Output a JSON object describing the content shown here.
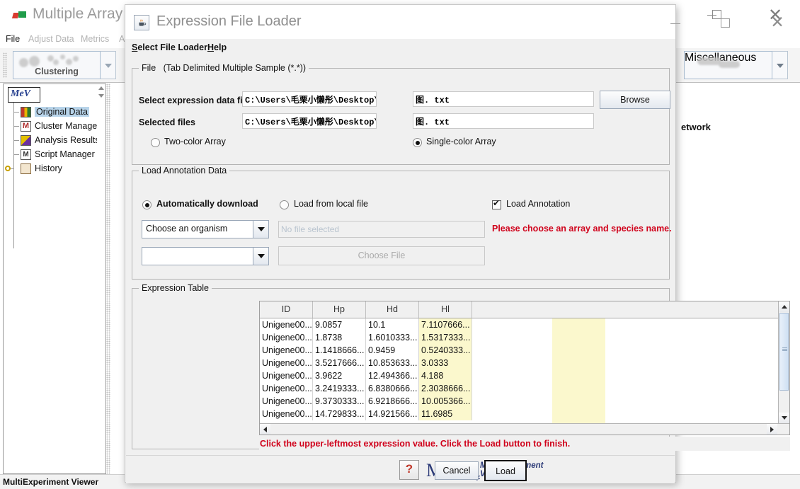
{
  "background_window": {
    "title": "Multiple Array V",
    "app_icon": "mev-flag-icon",
    "menus": [
      "File",
      "Adjust Data",
      "Metrics",
      "A"
    ],
    "toolbar_buttons": [
      "Clustering",
      "Miscellaneous"
    ],
    "tree": {
      "root_label": "MeV",
      "items": [
        {
          "label": "Original Data",
          "icon": "grid-data-icon",
          "selected": true
        },
        {
          "label": "Cluster Manager",
          "icon": "cluster-m-icon",
          "selected": false
        },
        {
          "label": "Analysis Results",
          "icon": "analysis-icon",
          "selected": false
        },
        {
          "label": "Script Manager",
          "icon": "script-m-icon",
          "selected": false
        },
        {
          "label": "History",
          "icon": "history-scroll-icon",
          "selected": false
        }
      ]
    },
    "canvas_text": "etwork",
    "status_text": "MultiExperiment Viewer",
    "window_controls": {
      "minimize": "minimize-icon",
      "maximize": "maximize-icon",
      "close": "close-icon"
    }
  },
  "dialog": {
    "title": "Expression File Loader",
    "icon": "java-coffee-cup-icon",
    "window_controls": {
      "minimize": "minimize-icon",
      "maximize": "maximize-icon",
      "close": "close-icon"
    },
    "menus": [
      {
        "label": "Select File Loader",
        "mnemonic": "S"
      },
      {
        "label": "Help",
        "mnemonic": "H"
      }
    ],
    "file_group": {
      "title": "File",
      "subtitle": "(Tab Delimited Multiple Sample (*.*))",
      "expression_file_label": "Select expression data file",
      "expression_file_path": "C:\\Users\\毛栗小懒彤\\Desktop\\",
      "expression_file_name": "图. txt",
      "selected_files_label": "Selected files",
      "selected_files_path": "C:\\Users\\毛栗小懒彤\\Desktop\\",
      "selected_files_name": "图. txt",
      "browse_label": "Browse",
      "two_color_label": "Two-color Array",
      "two_color_selected": false,
      "single_color_label": "Single-color Array",
      "single_color_selected": true
    },
    "annotation_group": {
      "title": "Load Annotation Data",
      "auto_download_label": "Automatically download",
      "auto_download_selected": true,
      "local_file_label": "Load from local file",
      "local_file_selected": false,
      "load_annotation_label": "Load Annotation",
      "load_annotation_checked": true,
      "organism_combo_value": "Choose an organism",
      "array_combo_value": "",
      "no_file_placeholder": "No file selected",
      "choose_file_label": "Choose File",
      "error_message": "Please choose an array and species name.",
      "error_color": "#d0021b"
    },
    "expression_table": {
      "title": "Expression Table",
      "columns": [
        "ID",
        "Hp",
        "Hd",
        "Hl"
      ],
      "highlight_column_index": 3,
      "highlight_color": "#fbf8cd",
      "rows": [
        [
          "Unigene00...",
          "9.0857",
          "10.1",
          "7.1107666..."
        ],
        [
          "Unigene00...",
          "1.8738",
          "1.6010333...",
          "1.5317333..."
        ],
        [
          "Unigene00...",
          "1.1418666...",
          "0.9459",
          "0.5240333..."
        ],
        [
          "Unigene00...",
          "3.5217666...",
          "10.853633...",
          "3.0333"
        ],
        [
          "Unigene00...",
          "3.9622",
          "12.494366...",
          "4.188"
        ],
        [
          "Unigene00...",
          "3.2419333...",
          "6.8380666...",
          "2.3038666..."
        ],
        [
          "Unigene00...",
          "9.3730333...",
          "6.9218666...",
          "10.005366..."
        ],
        [
          "Unigene00...",
          "14.729833...",
          "14.921566...",
          "11.6985"
        ]
      ]
    },
    "hint_message": "Click the upper-leftmost expression value. Click the Load button to finish.",
    "footer": {
      "help_icon": "question-mark-icon",
      "logo_text": "MeV",
      "logo_star": "∗",
      "logo_sub_line1": "MultiExperiment",
      "logo_sub_line2": "Viewer",
      "cancel_label": "Cancel",
      "load_label": "Load"
    }
  }
}
